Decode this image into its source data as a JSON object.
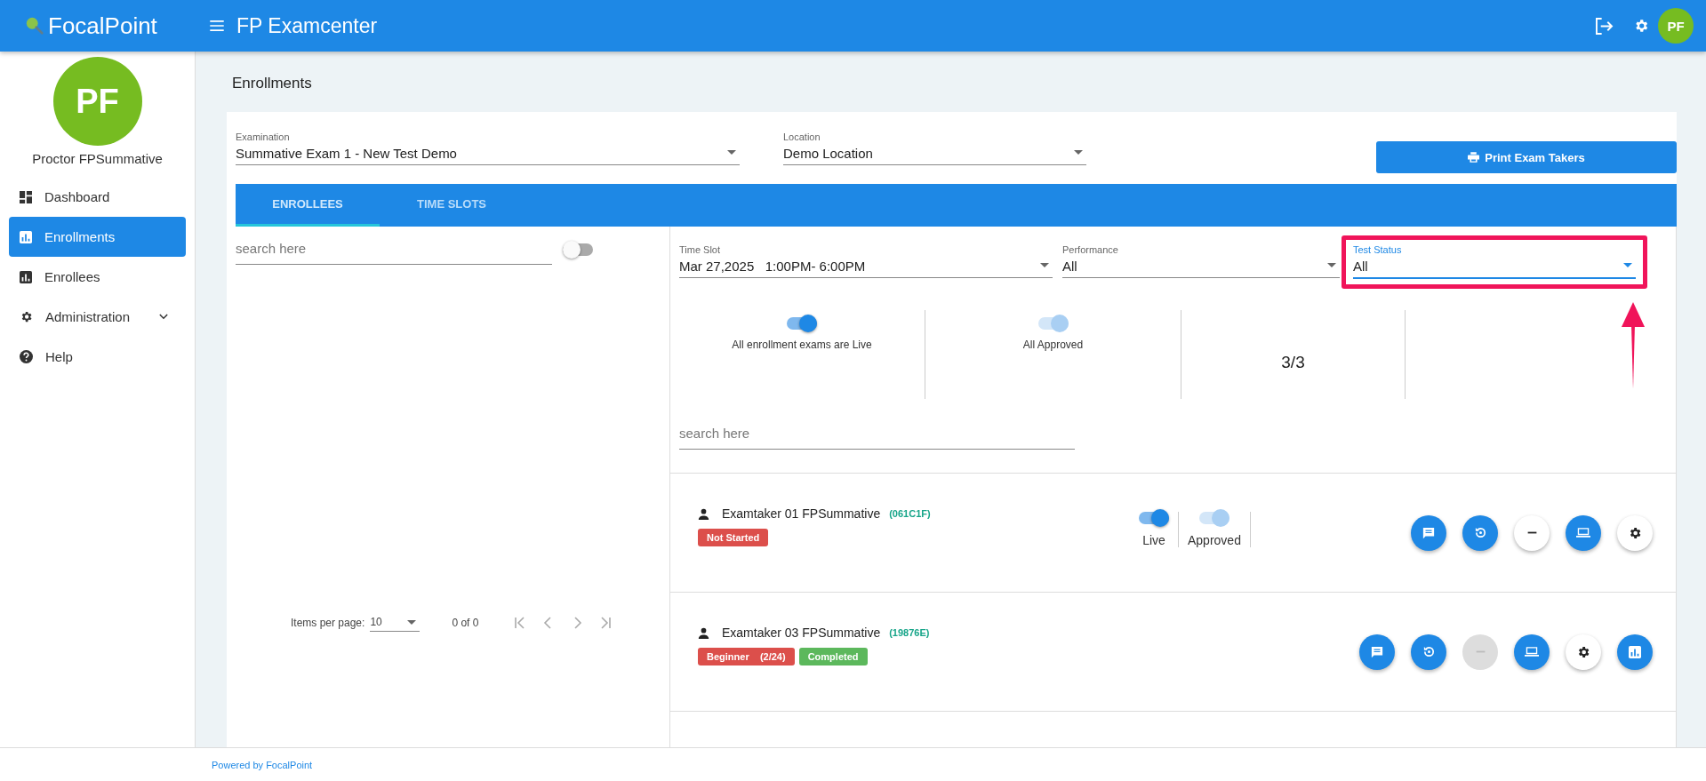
{
  "app_bar": {
    "logo": "FocalPoint",
    "title": "FP Examcenter",
    "avatar": "PF"
  },
  "sidebar": {
    "avatar": "PF",
    "user": "Proctor FPSummative",
    "items": [
      {
        "label": "Dashboard",
        "kind": "dashboard",
        "selected": false,
        "expandable": false
      },
      {
        "label": "Enrollments",
        "kind": "chart",
        "selected": true,
        "expandable": false
      },
      {
        "label": "Enrollees",
        "kind": "chart",
        "selected": false,
        "expandable": false
      },
      {
        "label": "Administration",
        "kind": "settings",
        "selected": false,
        "expandable": true
      },
      {
        "label": "Help",
        "kind": "help",
        "selected": false,
        "expandable": false
      }
    ]
  },
  "page_title": "Enrollments",
  "filters": [
    {
      "label": "Examination",
      "value": "Summative Exam 1 - New Test Demo"
    },
    {
      "label": "Location",
      "value": "Demo Location"
    }
  ],
  "print_button": "Print Exam Takers",
  "tabs": [
    {
      "label": "ENROLLEES",
      "selected": true
    },
    {
      "label": "TIME SLOTS",
      "selected": false
    }
  ],
  "left_panel": {
    "search": {
      "placeholder": "search here"
    },
    "toggle": {
      "checked": false
    },
    "pagination": {
      "label": "Items per page:",
      "page_size": "10",
      "range": "0 of 0"
    }
  },
  "right_panel": {
    "filters": [
      {
        "label": "Time Slot",
        "value": "Mar 27,2025   1:00PM- 6:00PM",
        "highlighted": false
      },
      {
        "label": "Performance",
        "value": "All",
        "highlighted": false
      },
      {
        "label": "Test Status",
        "value": "All",
        "highlighted": true
      }
    ],
    "summary": [
      {
        "kind": "toggle",
        "label": "All enrollment exams are Live",
        "checked": true,
        "disabled": false
      },
      {
        "kind": "toggle",
        "label": "All Approved",
        "checked": true,
        "disabled": true
      },
      {
        "kind": "count",
        "value": "3/3"
      }
    ],
    "search": {
      "placeholder": "search here"
    },
    "enrollees": [
      {
        "name": "Examtaker 01 FPSummative",
        "code": "(061C1F)",
        "badges": [
          {
            "label": "Not Started",
            "color": "#dc4f4b"
          }
        ],
        "toggles": [
          {
            "label": "Live",
            "checked": true,
            "disabled": false
          },
          {
            "label": "Approved",
            "checked": true,
            "disabled": true
          }
        ],
        "actions": [
          {
            "kind": "message",
            "filled": true,
            "disabled": false
          },
          {
            "kind": "reset",
            "filled": true,
            "disabled": false
          },
          {
            "kind": "remove",
            "filled": false,
            "disabled": false
          },
          {
            "kind": "screen",
            "filled": true,
            "disabled": false
          },
          {
            "kind": "settings",
            "filled": false,
            "disabled": false
          }
        ]
      },
      {
        "name": "Examtaker 03 FPSummative",
        "code": "(19876E)",
        "badges": [
          {
            "label": "Beginner",
            "detail": "(2/24)",
            "color": "#dc4f4b"
          },
          {
            "label": "Completed",
            "color": "#5cb85c"
          }
        ],
        "actions": [
          {
            "kind": "message",
            "filled": true,
            "disabled": false
          },
          {
            "kind": "reset",
            "filled": true,
            "disabled": false
          },
          {
            "kind": "remove",
            "filled": false,
            "disabled": true
          },
          {
            "kind": "screen",
            "filled": true,
            "disabled": false
          },
          {
            "kind": "settings",
            "filled": false,
            "disabled": false
          },
          {
            "kind": "report",
            "filled": true,
            "disabled": false
          }
        ]
      }
    ]
  },
  "footer": "Powered by FocalPoint"
}
